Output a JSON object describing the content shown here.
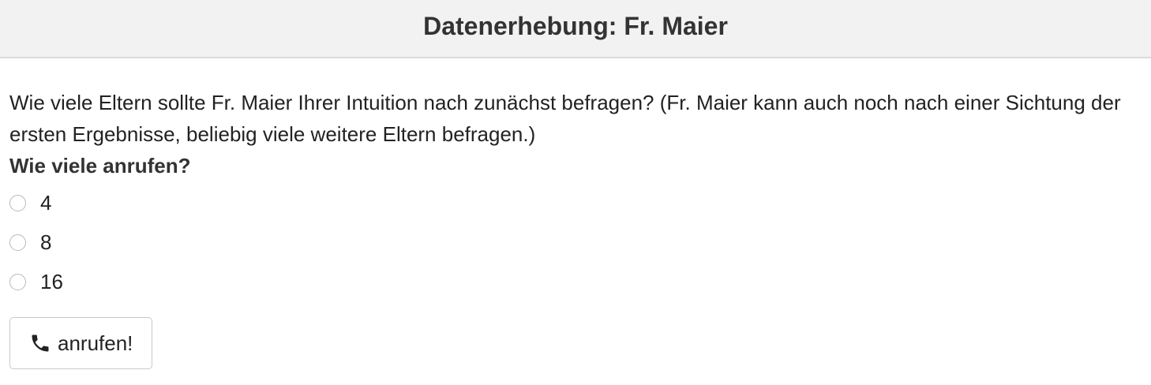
{
  "header": {
    "title": "Datenerhebung: Fr. Maier"
  },
  "main": {
    "question": "Wie viele Eltern sollte Fr. Maier Ihrer Intuition nach zunächst befragen? (Fr. Maier kann auch noch nach einer Sichtung der ersten Ergebnisse, beliebig viele weitere Eltern befragen.)",
    "subquestion": "Wie viele anrufen?",
    "options": [
      {
        "label": "4",
        "selected": false
      },
      {
        "label": "8",
        "selected": false
      },
      {
        "label": "16",
        "selected": false
      }
    ],
    "button": {
      "label": "anrufen!",
      "icon": "phone-icon"
    }
  }
}
